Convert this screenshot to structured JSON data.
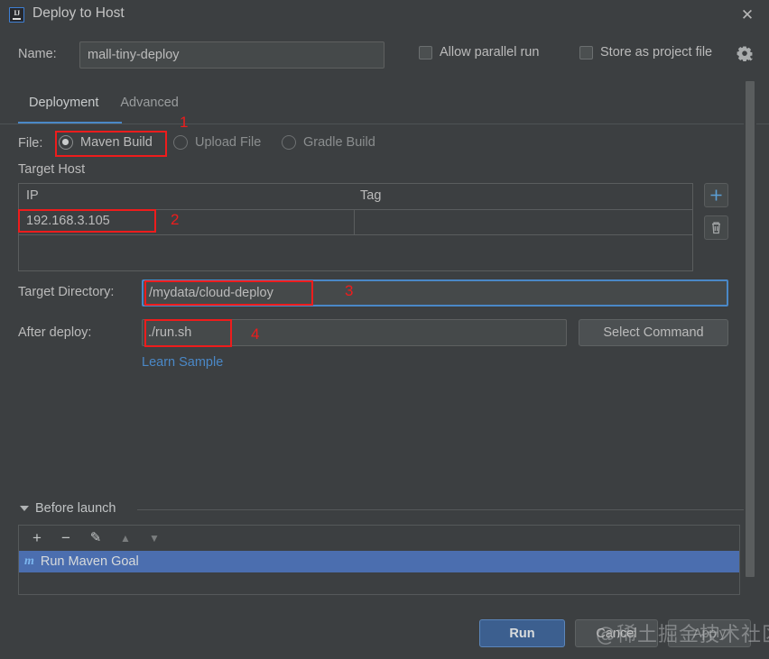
{
  "window": {
    "title": "Deploy to Host",
    "app_icon": "intellij-idea-icon",
    "ij_mark": "IJ",
    "close_icon": "✕"
  },
  "header": {
    "name_label": "Name:",
    "name_value": "mall-tiny-deploy",
    "name_placeholder": "",
    "allow_parallel_run_label": "Allow parallel run",
    "allow_parallel_run_checked": false,
    "store_as_project_file_label": "Store as project file",
    "store_as_project_file_checked": false,
    "gear_icon": "gear-icon"
  },
  "tabs": [
    {
      "label": "Deployment",
      "active": true
    },
    {
      "label": "Advanced",
      "active": false
    }
  ],
  "file_row": {
    "label": "File:",
    "options": [
      {
        "label": "Maven Build",
        "selected": true
      },
      {
        "label": "Upload File",
        "selected": false
      },
      {
        "label": "Gradle Build",
        "selected": false
      }
    ]
  },
  "target_host": {
    "section_label": "Target Host",
    "columns": [
      "IP",
      "Tag"
    ],
    "rows": [
      {
        "ip": "192.168.3.105",
        "tag": ""
      }
    ],
    "add_icon": "plus-icon",
    "delete_icon": "trash-icon"
  },
  "fields": {
    "target_directory_label": "Target Directory:",
    "target_directory_value": "/mydata/cloud-deploy",
    "after_deploy_label": "After deploy:",
    "after_deploy_value": "./run.sh",
    "select_command_label": "Select Command",
    "learn_sample_label": "Learn Sample"
  },
  "before_launch": {
    "section_label": "Before launch",
    "toolbar": [
      {
        "icon": "plus-icon",
        "label": "+",
        "enabled": true
      },
      {
        "icon": "minus-icon",
        "label": "−",
        "enabled": true
      },
      {
        "icon": "pencil-icon",
        "label": "✎",
        "enabled": true
      },
      {
        "icon": "arrow-up-icon",
        "label": "▲",
        "enabled": false
      },
      {
        "icon": "arrow-down-icon",
        "label": "▼",
        "enabled": false
      }
    ],
    "items": [
      {
        "icon_text": "m",
        "label": "Run Maven Goal",
        "selected": true
      }
    ]
  },
  "footer": {
    "run_label": "Run",
    "cancel_label": "Cancel",
    "apply_label": "Apply"
  },
  "annotations": [
    {
      "number": "1"
    },
    {
      "number": "2"
    },
    {
      "number": "3"
    },
    {
      "number": "4"
    }
  ],
  "watermark": {
    "text": "@稀土掘金技术社区"
  },
  "colors": {
    "background": "#3c3f41",
    "input_bg": "#45494a",
    "accent_blue": "#4a88c7",
    "selection_blue": "#4b6eaf",
    "run_button": "#3c5f8f",
    "annotation_red": "#ee1c1c",
    "link_blue": "#4a88c7",
    "text": "#bbbbbb"
  }
}
